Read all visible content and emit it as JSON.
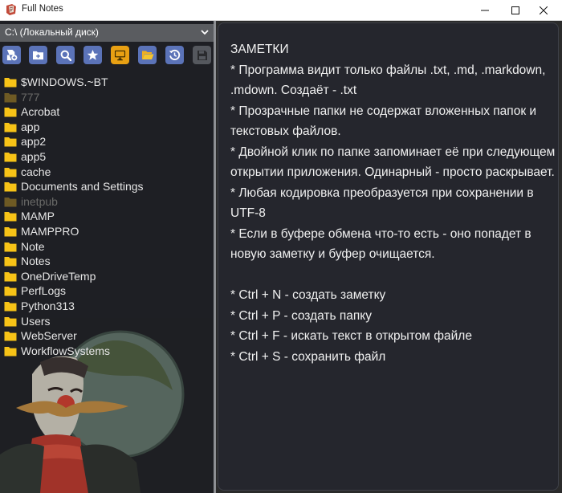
{
  "window": {
    "title": "Full Notes",
    "controls": [
      "minimize-icon",
      "maximize-icon",
      "close-icon"
    ]
  },
  "sidebar": {
    "drive": "C:\\ (Локальный диск)",
    "toolbar": [
      {
        "icon": "new-note-icon"
      },
      {
        "icon": "new-folder-icon"
      },
      {
        "icon": "search-icon"
      },
      {
        "icon": "star-icon"
      },
      {
        "icon": "monitor-icon"
      },
      {
        "icon": "open-folder-icon"
      },
      {
        "icon": "history-icon"
      },
      {
        "icon": "save-icon"
      }
    ],
    "folders": [
      {
        "label": "$WINDOWS.~BT",
        "dim": false
      },
      {
        "label": "777",
        "dim": true
      },
      {
        "label": "Acrobat",
        "dim": false
      },
      {
        "label": "app",
        "dim": false
      },
      {
        "label": "app2",
        "dim": false
      },
      {
        "label": "app5",
        "dim": false
      },
      {
        "label": "cache",
        "dim": false
      },
      {
        "label": "Documents and Settings",
        "dim": false
      },
      {
        "label": "inetpub",
        "dim": true
      },
      {
        "label": "MAMP",
        "dim": false
      },
      {
        "label": "MAMPPRO",
        "dim": false
      },
      {
        "label": "Note",
        "dim": false
      },
      {
        "label": "Notes",
        "dim": false
      },
      {
        "label": "OneDriveTemp",
        "dim": false
      },
      {
        "label": "PerfLogs",
        "dim": false
      },
      {
        "label": "Python313",
        "dim": false
      },
      {
        "label": "Users",
        "dim": false
      },
      {
        "label": "WebServer",
        "dim": false
      },
      {
        "label": "WorkflowSystems",
        "dim": false
      }
    ]
  },
  "editor": {
    "text": "ЗАМЕТКИ\n* Программа видит только файлы .txt, .md, .markdown, .mdown. Создаёт - .txt\n* Прозрачные папки не содержат вложенных папок и текстовых файлов.\n* Двойной клик по папке запоминает её при следующем открытии приложения. Одинарный - просто раскрывает.\n* Любая кодировка преобразуется при сохранении в UTF-8\n* Если в буфере обмена что-то есть - оно попадет в новую заметку и буфер очищается.\n\n* Ctrl + N - создать заметку\n* Ctrl + P - создать папку\n* Ctrl + F - искать текст в открытом файле\n* Ctrl + S - сохранить файл"
  },
  "colors": {
    "folder": "#f7c317",
    "folder_dim": "#6e5a24",
    "button": "#5b73b8",
    "button_orange": "#e8a013",
    "button_disabled": "#55585e",
    "sidebar_bg": "#1e1f24",
    "editor_bg": "#25262d"
  }
}
